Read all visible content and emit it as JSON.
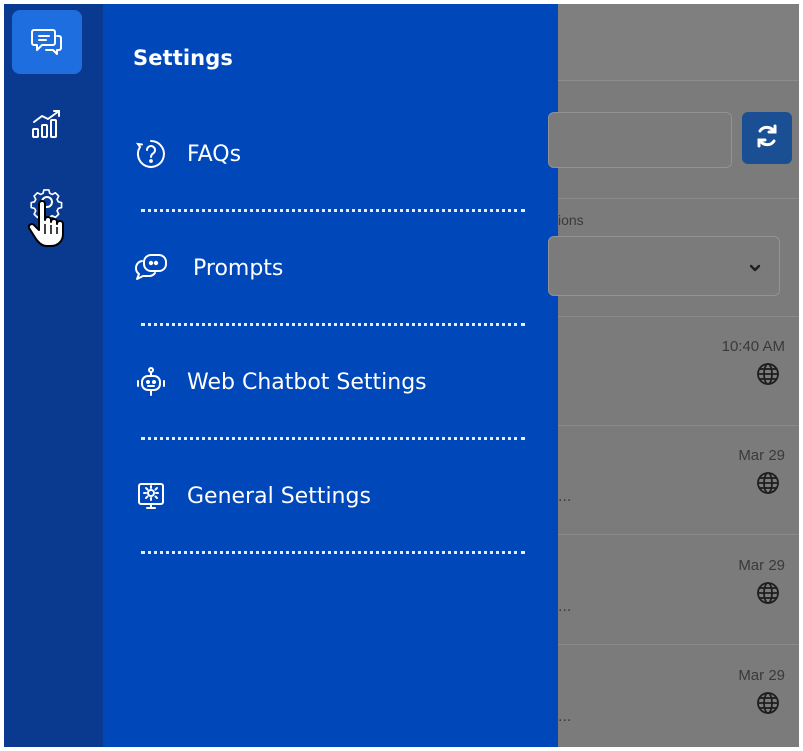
{
  "rail": {
    "items": [
      {
        "icon": "chat-icon",
        "active": true
      },
      {
        "icon": "analytics-icon",
        "active": false
      },
      {
        "icon": "gear-icon",
        "active": false
      }
    ]
  },
  "panel": {
    "title": "Settings",
    "items": [
      {
        "label": "FAQs",
        "icon": "question-circle-icon"
      },
      {
        "label": "Prompts",
        "icon": "chat-bubbles-icon"
      },
      {
        "label": "Web Chatbot Settings",
        "icon": "robot-icon"
      },
      {
        "label": "General Settings",
        "icon": "settings-monitor-icon"
      }
    ]
  },
  "background": {
    "filter_label_partial": "ions",
    "conversations": [
      {
        "time": "10:40 AM",
        "icon": "globe-icon"
      },
      {
        "time": "Mar 29",
        "icon": "globe-icon",
        "snippet": "..."
      },
      {
        "time": "Mar 29",
        "icon": "globe-icon",
        "snippet": "..."
      },
      {
        "time": "Mar 29",
        "icon": "globe-icon",
        "snippet": "..."
      }
    ]
  },
  "colors": {
    "rail_bg": "#0a3a8f",
    "panel_bg": "#0047ba",
    "active_rail_btn": "#1f6ee0",
    "overlay": "#7b7b7b",
    "refresh_button": "#1a4f93"
  }
}
